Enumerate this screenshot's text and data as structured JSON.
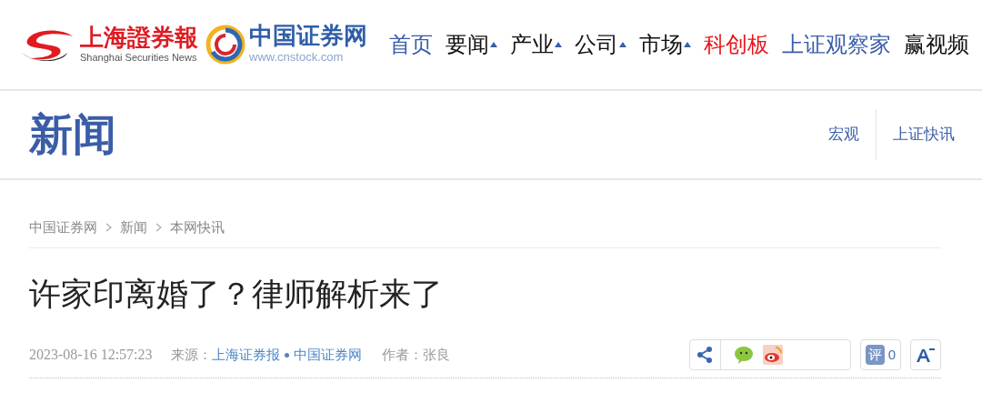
{
  "header": {
    "logo_left": {
      "title": "上海證券報",
      "subtitle": "Shanghai Securities News"
    },
    "logo_right": {
      "title": "中国证券网",
      "subtitle": "www.cnstock.com"
    },
    "nav": [
      {
        "label": "首页",
        "dropdown": false,
        "color": "#3a5da8"
      },
      {
        "label": "要闻",
        "dropdown": true,
        "color": "#111111"
      },
      {
        "label": "产业",
        "dropdown": true,
        "color": "#111111"
      },
      {
        "label": "公司",
        "dropdown": true,
        "color": "#111111"
      },
      {
        "label": "市场",
        "dropdown": true,
        "color": "#111111"
      },
      {
        "label": "科创板",
        "dropdown": false,
        "color": "#e8141b"
      },
      {
        "label": "上证观察家",
        "dropdown": false,
        "color": "#3a5da8"
      },
      {
        "label": "赢视频",
        "dropdown": false,
        "color": "#111111"
      }
    ]
  },
  "section": {
    "title": "新闻",
    "links": [
      "宏观",
      "上证快讯"
    ]
  },
  "breadcrumb": [
    "中国证券网",
    "新闻",
    "本网快讯"
  ],
  "article": {
    "title": "许家印离婚了？律师解析来了",
    "datetime": "2023-08-16 12:57:23",
    "source_label": "来源：",
    "sources": [
      "上海证券报",
      "中国证券网"
    ],
    "author_label": "作者：",
    "author": "张良",
    "comment_icon": "评",
    "comment_count": "0"
  }
}
